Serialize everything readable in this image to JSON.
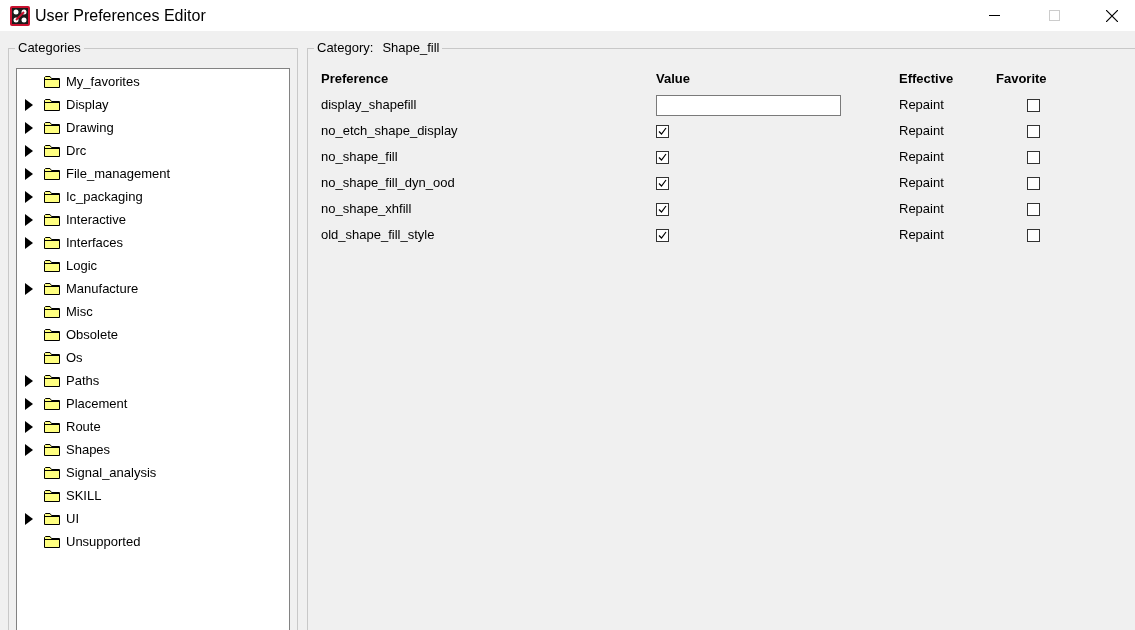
{
  "window": {
    "title": "User Preferences Editor"
  },
  "categories": {
    "title": "Categories",
    "items": [
      {
        "label": "My_favorites",
        "kind": "leaf"
      },
      {
        "label": "Display",
        "kind": "group"
      },
      {
        "label": "Drawing",
        "kind": "group"
      },
      {
        "label": "Drc",
        "kind": "group"
      },
      {
        "label": "File_management",
        "kind": "group"
      },
      {
        "label": "Ic_packaging",
        "kind": "group"
      },
      {
        "label": "Interactive",
        "kind": "group"
      },
      {
        "label": "Interfaces",
        "kind": "group"
      },
      {
        "label": "Logic",
        "kind": "leaf"
      },
      {
        "label": "Manufacture",
        "kind": "group"
      },
      {
        "label": "Misc",
        "kind": "leaf"
      },
      {
        "label": "Obsolete",
        "kind": "leaf"
      },
      {
        "label": "Os",
        "kind": "leaf"
      },
      {
        "label": "Paths",
        "kind": "group"
      },
      {
        "label": "Placement",
        "kind": "group"
      },
      {
        "label": "Route",
        "kind": "group"
      },
      {
        "label": "Shapes",
        "kind": "group"
      },
      {
        "label": "Signal_analysis",
        "kind": "leaf"
      },
      {
        "label": "SKILL",
        "kind": "leaf"
      },
      {
        "label": "UI",
        "kind": "group"
      },
      {
        "label": "Unsupported",
        "kind": "leaf"
      }
    ]
  },
  "preferences": {
    "category_label": "Category:",
    "category": "Shape_fill",
    "columns": [
      "Preference",
      "Value",
      "Effective",
      "Favorite"
    ],
    "rows": [
      {
        "name": "display_shapefill",
        "kind": "text",
        "effective": "Repaint",
        "favorite": false
      },
      {
        "name": "no_etch_shape_display",
        "kind": "checkbox",
        "checked": true,
        "effective": "Repaint",
        "favorite": false
      },
      {
        "name": "no_shape_fill",
        "kind": "checkbox",
        "checked": true,
        "effective": "Repaint",
        "favorite": false
      },
      {
        "name": "no_shape_fill_dyn_ood",
        "kind": "checkbox",
        "checked": true,
        "effective": "Repaint",
        "favorite": false
      },
      {
        "name": "no_shape_xhfill",
        "kind": "checkbox",
        "checked": true,
        "effective": "Repaint",
        "favorite": false
      },
      {
        "name": "old_shape_fill_style",
        "kind": "checkbox",
        "checked": true,
        "effective": "Repaint",
        "favorite": false
      }
    ]
  }
}
